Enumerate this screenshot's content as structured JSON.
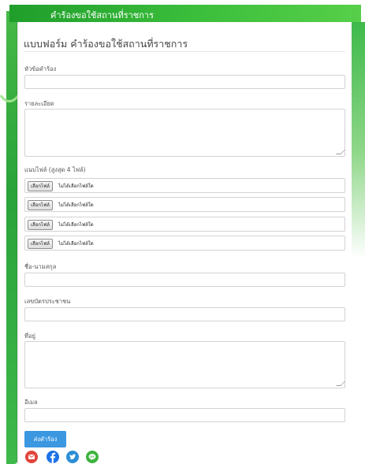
{
  "banner": {
    "title": "คำร้องขอใช้สถานที่ราชการ"
  },
  "form": {
    "title": "แบบฟอร์ม คำร้องขอใช้สถานที่ราชการ",
    "fields": {
      "subject": {
        "label": "หัวข้อคำร้อง",
        "value": ""
      },
      "details": {
        "label": "รายละเอียด",
        "value": ""
      },
      "attachments": {
        "label": "แนบไฟล์ (สูงสุด 4 ไฟล์)",
        "items": [
          {
            "button": "เลือกไฟล์",
            "status": "ไม่ได้เลือกไฟล์ใด"
          },
          {
            "button": "เลือกไฟล์",
            "status": "ไม่ได้เลือกไฟล์ใด"
          },
          {
            "button": "เลือกไฟล์",
            "status": "ไม่ได้เลือกไฟล์ใด"
          },
          {
            "button": "เลือกไฟล์",
            "status": "ไม่ได้เลือกไฟล์ใด"
          }
        ]
      },
      "fullname": {
        "label": "ชื่อ-นามสกุล",
        "value": ""
      },
      "id_card": {
        "label": "เลขบัตรประชาชน",
        "value": ""
      },
      "address": {
        "label": "ที่อยู่",
        "value": ""
      },
      "email": {
        "label": "อีเมล",
        "value": ""
      }
    },
    "submit_label": "ส่งคำร้อง"
  },
  "share": [
    {
      "icon": "email-icon",
      "color": "#e0453b"
    },
    {
      "icon": "facebook-icon",
      "color": "#1d72e8"
    },
    {
      "icon": "twitter-icon",
      "color": "#2c8fd6"
    },
    {
      "icon": "line-icon",
      "color": "#3cb43c"
    }
  ],
  "colors": {
    "banner": "#2aa33a",
    "submit": "#3a97e0"
  }
}
